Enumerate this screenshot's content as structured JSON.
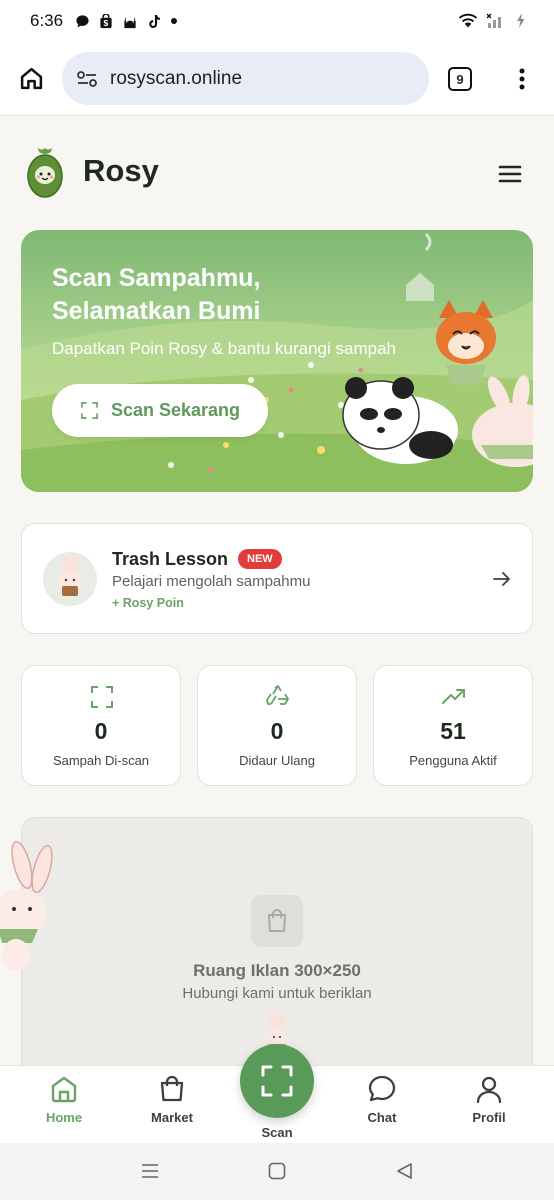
{
  "status": {
    "time": "6:36"
  },
  "browser": {
    "url": "rosyscan.online",
    "tab_count": "9"
  },
  "header": {
    "brand": "Rosy"
  },
  "hero": {
    "title": "Scan Sampahmu, Selamatkan Bumi",
    "subtitle": "Dapatkan Poin Rosy & bantu kurangi sampah",
    "cta_label": "Scan Sekarang"
  },
  "lesson": {
    "title": "Trash Lesson",
    "badge": "NEW",
    "description": "Pelajari mengolah sampahmu",
    "points": "+ Rosy Poin"
  },
  "stats": [
    {
      "value": "0",
      "label": "Sampah Di-scan",
      "icon": "scan-icon"
    },
    {
      "value": "0",
      "label": "Didaur Ulang",
      "icon": "recycle-icon"
    },
    {
      "value": "51",
      "label": "Pengguna Aktif",
      "icon": "trending-up-icon"
    }
  ],
  "ad": {
    "title": "Ruang Iklan 300×250",
    "subtitle": "Hubungi kami untuk beriklan"
  },
  "nav": {
    "home": "Home",
    "market": "Market",
    "scan": "Scan",
    "chat": "Chat",
    "profile": "Profil"
  },
  "colors": {
    "accent": "#5a9a58",
    "accent_text": "#6aa366",
    "badge": "#e23b3b"
  }
}
